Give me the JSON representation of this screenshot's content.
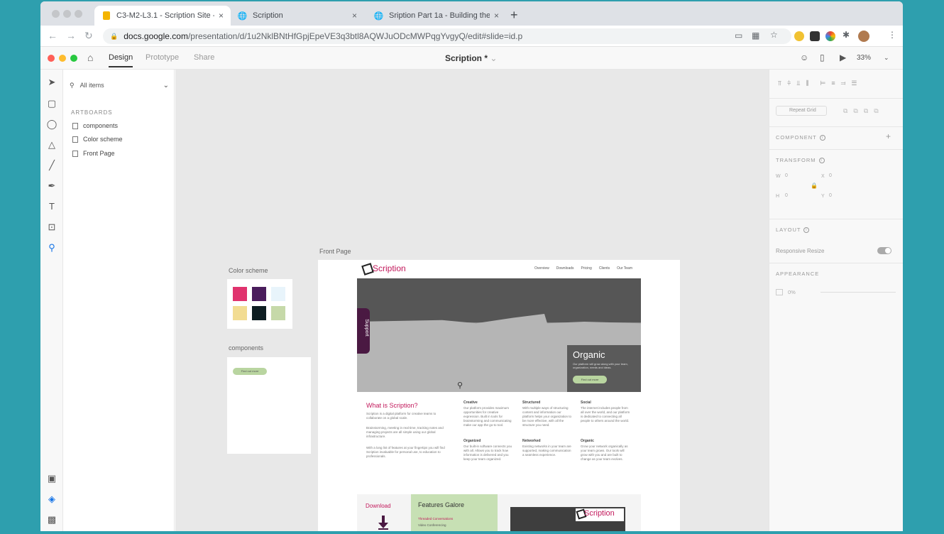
{
  "browser": {
    "tabs": [
      {
        "title": "C3-M2-L3.1 - Scription Site - ...",
        "active": true
      },
      {
        "title": "Scription",
        "active": false
      },
      {
        "title": "Sription Part 1a - Building the ...",
        "active": false
      }
    ],
    "new_tab": "+",
    "url_host": "docs.google.com",
    "url_path": "/presentation/d/1u2NklBNtHfGpjEpeVE3q3btl8AQWJuODcMWPqgYvgyQ/edit#slide=id.p"
  },
  "xd": {
    "tabs": {
      "design": "Design",
      "prototype": "Prototype",
      "share": "Share"
    },
    "doc_title": "Scription *",
    "zoom": "33%"
  },
  "layers": {
    "filter": "All items",
    "heading": "ARTBOARDS",
    "artboards": [
      "components",
      "Color scheme",
      "Front Page"
    ]
  },
  "canvas": {
    "color_scheme_label": "Color scheme",
    "components_label": "components",
    "front_page_label": "Front Page",
    "swatches": [
      "#e0336e",
      "#4a1d5c",
      "#e8f4fb",
      "#f2dc92",
      "#0e1e22",
      "#c6d9a9"
    ],
    "component_button": "Find out more",
    "site": {
      "logo": "Scription",
      "nav": [
        "Overview",
        "Downloads",
        "Pricing",
        "Clients",
        "Our Team"
      ],
      "support_tab": "Support",
      "hero_title": "Organic",
      "hero_text": "Our platform will grow along with your team, organization, needs and ideas.",
      "hero_button": "Find out more",
      "what_heading": "What is Scription?",
      "what_p1": "Scription is a digital platform for creative teams to collaborate on a global scale.",
      "what_p2": "Brainstorming, meeting in real time, tracking notes and managing projects are all simple using our global infrastructure.",
      "what_p3": "With a long list of features at your fingertips you will find Scription invaluable for personal use, to education to professionals.",
      "features": [
        {
          "title": "Creative",
          "text": "Our platform provides maximum opportunities for creative expression. Built in tools for brainstorming and communicating make our app the go-to tool."
        },
        {
          "title": "Structured",
          "text": "With multiple ways of structuring content and information our platform helps your organization to be more effective, with all the structure you need."
        },
        {
          "title": "Social",
          "text": "The internet includes people from all over the world, and our platform is dedicated to connecting all people to others around the world."
        },
        {
          "title": "Organized",
          "text": "Our built-in software connects you with all. Allows you to track how information is delivered and you keep your team organized."
        },
        {
          "title": "Networked",
          "text": "Existing networks in your team are supported, making communication a seamless experience."
        },
        {
          "title": "Organic",
          "text": "Grow your network organically as your team grows. Our tools will grow with you and are built to change as your team evolves."
        }
      ],
      "download": "Download",
      "features_heading": "Features Galore",
      "features_list": [
        "Threaded Conversations",
        "Video Conferencing"
      ],
      "thumb_logo": "Scription"
    }
  },
  "inspector": {
    "repeat_grid": "Repeat Grid",
    "component": "COMPONENT",
    "transform": "TRANSFORM",
    "w": "W",
    "w_val": "0",
    "x": "X",
    "x_val": "0",
    "h": "H",
    "h_val": "0",
    "y": "Y",
    "y_val": "0",
    "layout": "LAYOUT",
    "responsive_resize": "Responsive Resize",
    "appearance": "APPEARANCE",
    "opacity": "0%"
  }
}
